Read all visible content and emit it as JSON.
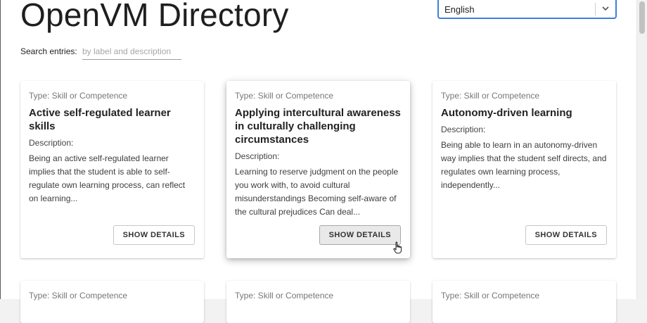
{
  "header": {
    "title": "OpenVM Directory"
  },
  "language": {
    "selected": "English"
  },
  "search": {
    "label": "Search entries:",
    "placeholder": "by label and description",
    "value": ""
  },
  "cards": [
    {
      "type": "Type: Skill or Competence",
      "title": "Active self-regulated learner skills",
      "description_label": "Description:",
      "description": "Being an active self-regulated learner implies that the student is able to self-regulate own learning process, can reflect on learning...",
      "button": "SHOW DETAILS"
    },
    {
      "type": "Type: Skill or Competence",
      "title": "Applying intercultural awareness in culturally challenging circumstances",
      "description_label": "Description:",
      "description": "Learning to reserve judgment on the people you work with, to avoid cultural misunderstandings Becoming self-aware of the cultural prejudices Can deal...",
      "button": "SHOW DETAILS"
    },
    {
      "type": "Type: Skill or Competence",
      "title": "Autonomy-driven learning",
      "description_label": "Description:",
      "description": "Being able to learn in an autonomy-driven way implies that the student self directs, and regulates own learning process, independently...",
      "button": "SHOW DETAILS"
    },
    {
      "type": "Type: Skill or Competence"
    },
    {
      "type": "Type: Skill or Competence"
    },
    {
      "type": "Type: Skill or Competence"
    }
  ]
}
